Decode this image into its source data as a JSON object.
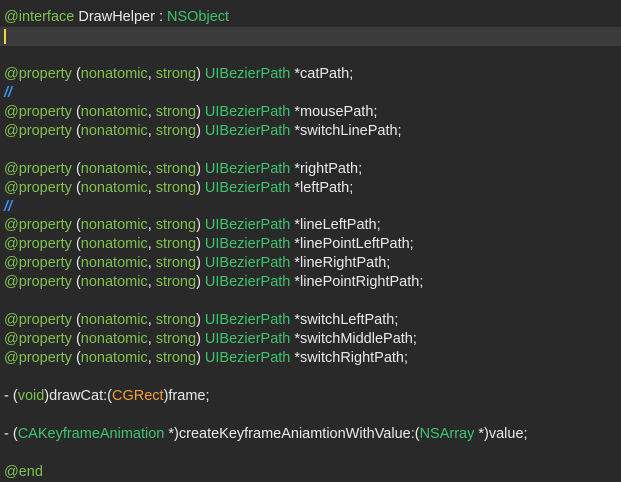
{
  "colors": {
    "background": "#292929",
    "current_line": "#3b3b3b",
    "cursor": "#f5d936",
    "keyword": "#7fc24f",
    "class_type": "#3fc46e",
    "plain_text": "#e9e9e9",
    "cg_type": "#f1a03c",
    "comment": "#3e8ff0"
  },
  "code": {
    "lines": [
      {
        "tokens": [
          {
            "t": "@interface",
            "c": "kw"
          },
          {
            "t": " DrawHelper : ",
            "c": "plain"
          },
          {
            "t": "NSObject",
            "c": "type"
          }
        ]
      },
      {
        "tokens": [],
        "current": true
      },
      {
        "tokens": []
      },
      {
        "tokens": [
          {
            "t": "@property",
            "c": "kw"
          },
          {
            "t": " (",
            "c": "plain"
          },
          {
            "t": "nonatomic",
            "c": "kw"
          },
          {
            "t": ", ",
            "c": "plain"
          },
          {
            "t": "strong",
            "c": "kw"
          },
          {
            "t": ") ",
            "c": "plain"
          },
          {
            "t": "UIBezierPath",
            "c": "type"
          },
          {
            "t": " *catPath;",
            "c": "plain"
          }
        ]
      },
      {
        "tokens": [
          {
            "t": "//",
            "c": "comment"
          }
        ]
      },
      {
        "tokens": [
          {
            "t": "@property",
            "c": "kw"
          },
          {
            "t": " (",
            "c": "plain"
          },
          {
            "t": "nonatomic",
            "c": "kw"
          },
          {
            "t": ", ",
            "c": "plain"
          },
          {
            "t": "strong",
            "c": "kw"
          },
          {
            "t": ") ",
            "c": "plain"
          },
          {
            "t": "UIBezierPath",
            "c": "type"
          },
          {
            "t": " *mousePath;",
            "c": "plain"
          }
        ]
      },
      {
        "tokens": [
          {
            "t": "@property",
            "c": "kw"
          },
          {
            "t": " (",
            "c": "plain"
          },
          {
            "t": "nonatomic",
            "c": "kw"
          },
          {
            "t": ", ",
            "c": "plain"
          },
          {
            "t": "strong",
            "c": "kw"
          },
          {
            "t": ") ",
            "c": "plain"
          },
          {
            "t": "UIBezierPath",
            "c": "type"
          },
          {
            "t": " *switchLinePath;",
            "c": "plain"
          }
        ]
      },
      {
        "tokens": []
      },
      {
        "tokens": [
          {
            "t": "@property",
            "c": "kw"
          },
          {
            "t": " (",
            "c": "plain"
          },
          {
            "t": "nonatomic",
            "c": "kw"
          },
          {
            "t": ", ",
            "c": "plain"
          },
          {
            "t": "strong",
            "c": "kw"
          },
          {
            "t": ") ",
            "c": "plain"
          },
          {
            "t": "UIBezierPath",
            "c": "type"
          },
          {
            "t": " *rightPath;",
            "c": "plain"
          }
        ]
      },
      {
        "tokens": [
          {
            "t": "@property",
            "c": "kw"
          },
          {
            "t": " (",
            "c": "plain"
          },
          {
            "t": "nonatomic",
            "c": "kw"
          },
          {
            "t": ", ",
            "c": "plain"
          },
          {
            "t": "strong",
            "c": "kw"
          },
          {
            "t": ") ",
            "c": "plain"
          },
          {
            "t": "UIBezierPath",
            "c": "type"
          },
          {
            "t": " *leftPath;",
            "c": "plain"
          }
        ]
      },
      {
        "tokens": [
          {
            "t": "//",
            "c": "comment"
          }
        ]
      },
      {
        "tokens": [
          {
            "t": "@property",
            "c": "kw"
          },
          {
            "t": " (",
            "c": "plain"
          },
          {
            "t": "nonatomic",
            "c": "kw"
          },
          {
            "t": ", ",
            "c": "plain"
          },
          {
            "t": "strong",
            "c": "kw"
          },
          {
            "t": ") ",
            "c": "plain"
          },
          {
            "t": "UIBezierPath",
            "c": "type"
          },
          {
            "t": " *lineLeftPath;",
            "c": "plain"
          }
        ]
      },
      {
        "tokens": [
          {
            "t": "@property",
            "c": "kw"
          },
          {
            "t": " (",
            "c": "plain"
          },
          {
            "t": "nonatomic",
            "c": "kw"
          },
          {
            "t": ", ",
            "c": "plain"
          },
          {
            "t": "strong",
            "c": "kw"
          },
          {
            "t": ") ",
            "c": "plain"
          },
          {
            "t": "UIBezierPath",
            "c": "type"
          },
          {
            "t": " *linePointLeftPath;",
            "c": "plain"
          }
        ]
      },
      {
        "tokens": [
          {
            "t": "@property",
            "c": "kw"
          },
          {
            "t": " (",
            "c": "plain"
          },
          {
            "t": "nonatomic",
            "c": "kw"
          },
          {
            "t": ", ",
            "c": "plain"
          },
          {
            "t": "strong",
            "c": "kw"
          },
          {
            "t": ") ",
            "c": "plain"
          },
          {
            "t": "UIBezierPath",
            "c": "type"
          },
          {
            "t": " *lineRightPath;",
            "c": "plain"
          }
        ]
      },
      {
        "tokens": [
          {
            "t": "@property",
            "c": "kw"
          },
          {
            "t": " (",
            "c": "plain"
          },
          {
            "t": "nonatomic",
            "c": "kw"
          },
          {
            "t": ", ",
            "c": "plain"
          },
          {
            "t": "strong",
            "c": "kw"
          },
          {
            "t": ") ",
            "c": "plain"
          },
          {
            "t": "UIBezierPath",
            "c": "type"
          },
          {
            "t": " *linePointRightPath;",
            "c": "plain"
          }
        ]
      },
      {
        "tokens": []
      },
      {
        "tokens": [
          {
            "t": "@property",
            "c": "kw"
          },
          {
            "t": " (",
            "c": "plain"
          },
          {
            "t": "nonatomic",
            "c": "kw"
          },
          {
            "t": ", ",
            "c": "plain"
          },
          {
            "t": "strong",
            "c": "kw"
          },
          {
            "t": ") ",
            "c": "plain"
          },
          {
            "t": "UIBezierPath",
            "c": "type"
          },
          {
            "t": " *switchLeftPath;",
            "c": "plain"
          }
        ]
      },
      {
        "tokens": [
          {
            "t": "@property",
            "c": "kw"
          },
          {
            "t": " (",
            "c": "plain"
          },
          {
            "t": "nonatomic",
            "c": "kw"
          },
          {
            "t": ", ",
            "c": "plain"
          },
          {
            "t": "strong",
            "c": "kw"
          },
          {
            "t": ") ",
            "c": "plain"
          },
          {
            "t": "UIBezierPath",
            "c": "type"
          },
          {
            "t": " *switchMiddlePath;",
            "c": "plain"
          }
        ]
      },
      {
        "tokens": [
          {
            "t": "@property",
            "c": "kw"
          },
          {
            "t": " (",
            "c": "plain"
          },
          {
            "t": "nonatomic",
            "c": "kw"
          },
          {
            "t": ", ",
            "c": "plain"
          },
          {
            "t": "strong",
            "c": "kw"
          },
          {
            "t": ") ",
            "c": "plain"
          },
          {
            "t": "UIBezierPath",
            "c": "type"
          },
          {
            "t": " *switchRightPath;",
            "c": "plain"
          }
        ]
      },
      {
        "tokens": []
      },
      {
        "tokens": [
          {
            "t": "- (",
            "c": "plain"
          },
          {
            "t": "void",
            "c": "kw"
          },
          {
            "t": ")drawCat:(",
            "c": "plain"
          },
          {
            "t": "CGRect",
            "c": "cg"
          },
          {
            "t": ")frame;",
            "c": "plain"
          }
        ]
      },
      {
        "tokens": []
      },
      {
        "tokens": [
          {
            "t": "- (",
            "c": "plain"
          },
          {
            "t": "CAKeyframeAnimation",
            "c": "type"
          },
          {
            "t": " *)createKeyframeAniamtionWithValue:(",
            "c": "plain"
          },
          {
            "t": "NSArray",
            "c": "type"
          },
          {
            "t": " *)value;",
            "c": "plain"
          }
        ]
      },
      {
        "tokens": []
      },
      {
        "tokens": [
          {
            "t": "@end",
            "c": "kw"
          }
        ]
      }
    ]
  }
}
